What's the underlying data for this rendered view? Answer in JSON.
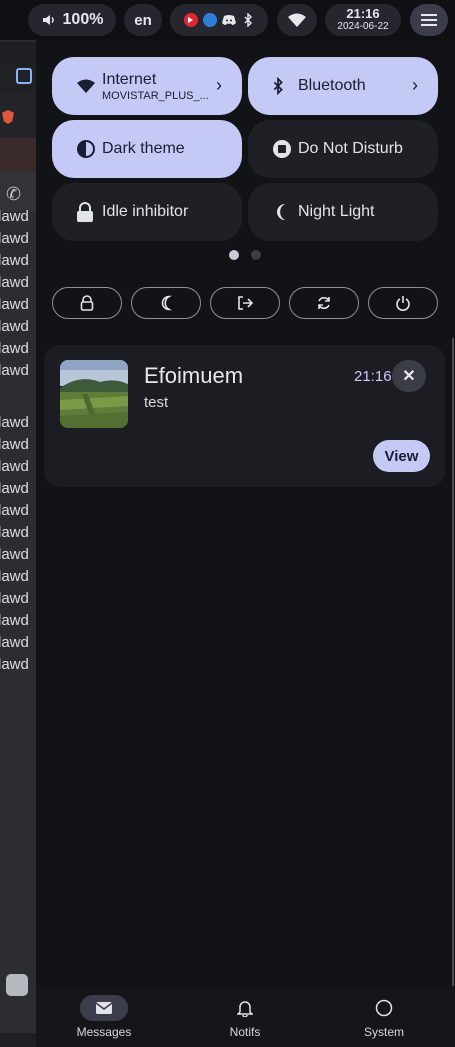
{
  "topbar": {
    "volume": "100%",
    "language": "en",
    "tray_icons": [
      "youtube-music-icon",
      "browser-badge-icon",
      "discord-icon",
      "bluetooth-icon"
    ],
    "clock_time": "21:16",
    "clock_date": "2024-06-22"
  },
  "background_app": {
    "lines": [
      "lawd",
      "lawd",
      "lawd",
      "lawd",
      "lawd",
      "lawd",
      "lawd",
      "lawd",
      "lawd",
      "lawd",
      "lawd",
      "lawd",
      "lawd",
      "lawd",
      "lawd",
      "lawd",
      "lawd",
      "lawd",
      "lawd",
      "lawd"
    ]
  },
  "quick_settings": {
    "internet": {
      "label": "Internet",
      "sub": "MOVISTAR_PLUS_...",
      "active": true
    },
    "bluetooth": {
      "label": "Bluetooth",
      "active": true
    },
    "dark_theme": {
      "label": "Dark theme",
      "active": true
    },
    "dnd": {
      "label": "Do Not Disturb",
      "active": false
    },
    "idle": {
      "label": "Idle inhibitor",
      "active": false
    },
    "night_light": {
      "label": "Night Light",
      "active": false
    },
    "page": 1,
    "pages": 2
  },
  "notification": {
    "title": "Efoimuem",
    "body": "test",
    "time": "21:16",
    "action": "View"
  },
  "bottom_nav": {
    "messages": "Messages",
    "notifs": "Notifs",
    "system": "System"
  },
  "colors": {
    "accent": "#c5c9f6",
    "panel_bg": "#121317",
    "tile_off": "#1f2026"
  }
}
